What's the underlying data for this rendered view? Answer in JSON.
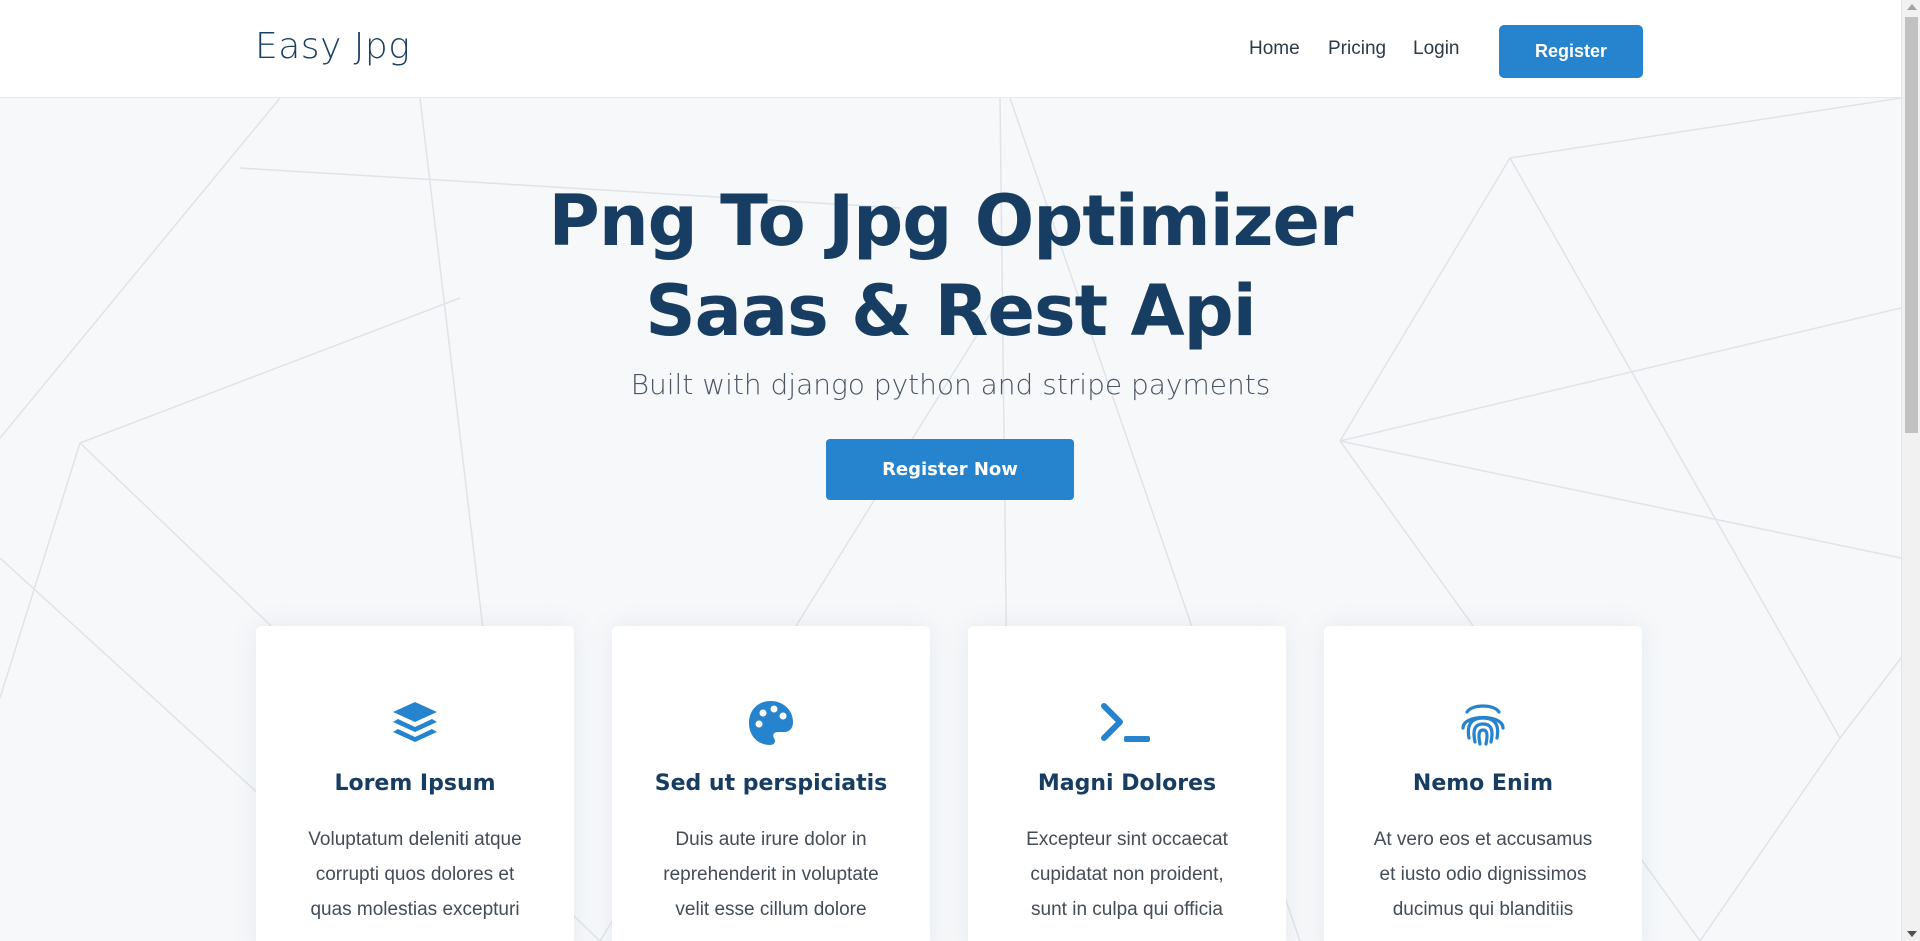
{
  "header": {
    "logo": "Easy Jpg",
    "nav": {
      "home": "Home",
      "pricing": "Pricing",
      "login": "Login"
    },
    "register_label": "Register"
  },
  "hero": {
    "title_line1": "Png To Jpg Optimizer",
    "title_line2": "Saas & Rest Api",
    "subtitle": "Built with django python and stripe payments",
    "cta_label": "Register Now"
  },
  "features": [
    {
      "icon": "layers-icon",
      "title": "Lorem Ipsum",
      "lines": [
        "Voluptatum deleniti atque",
        "corrupti quos dolores et",
        "quas molestias excepturi"
      ]
    },
    {
      "icon": "palette-icon",
      "title": "Sed ut perspiciatis",
      "lines": [
        "Duis aute irure dolor in",
        "reprehenderit in voluptate",
        "velit esse cillum dolore"
      ]
    },
    {
      "icon": "terminal-icon",
      "title": "Magni Dolores",
      "lines": [
        "Excepteur sint occaecat",
        "cupidatat non proident,",
        "sunt in culpa qui officia"
      ]
    },
    {
      "icon": "fingerprint-icon",
      "title": "Nemo Enim",
      "lines": [
        "At vero eos et accusamus",
        "et iusto odio dignissimos",
        "ducimus qui blanditiis"
      ]
    }
  ],
  "colors": {
    "accent": "#2683cd",
    "heading": "#173d63",
    "background": "#f6f8fa"
  }
}
